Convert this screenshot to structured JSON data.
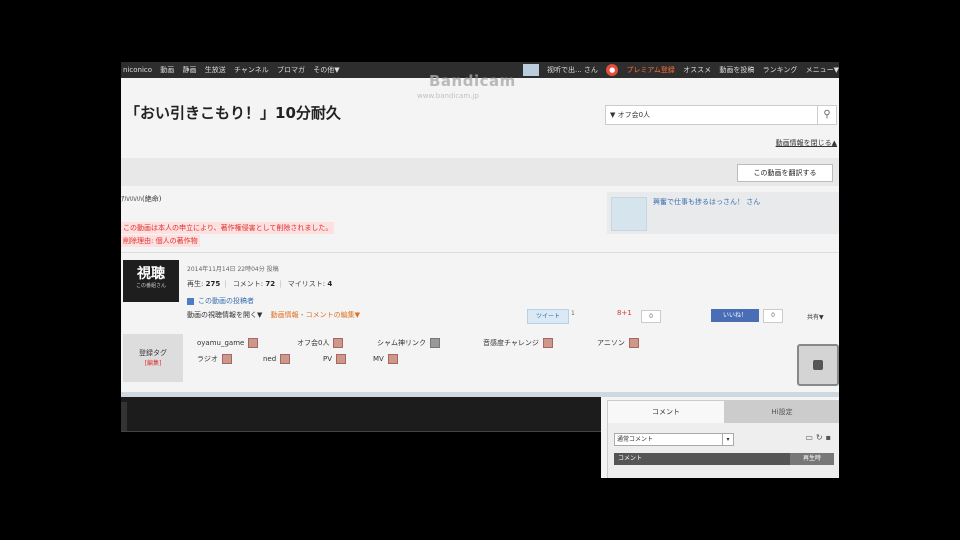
{
  "nav": {
    "left": [
      "niconico",
      "動画",
      "静画",
      "生放送",
      "チャンネル",
      "ブロマガ",
      "その他▼"
    ],
    "user": "视听で出... さん",
    "right": [
      "プレミアム登録",
      "オススメ",
      "動画を投稿",
      "ランキング",
      "メニュー▼"
    ]
  },
  "watermark": {
    "title": "Bandicam",
    "url": "www.bandicam.jp"
  },
  "video": {
    "title": "「おい引きこもり！」10分耐久",
    "search_placeholder": "▼ オフ会0人",
    "collapse_label": "動画情報を閉じる▲",
    "save_label": "この動画を翻訳する",
    "description": "ｱﾊﾊﾊﾊﾊ(絶命)",
    "notice1": "この動画は本人の申立により、著作権侵害として削除されました。",
    "notice2": "削除理由: 個人の著作物",
    "date": "2014年11月14日 22時04分 投稿",
    "stats": {
      "views_label": "再生:",
      "views": "275",
      "comments_label": "コメント:",
      "comments": "72",
      "mylist_label": "マイリスト:",
      "mylist": "4"
    },
    "owner_link": "この動画の投稿者",
    "links_a": "動画の視聴情報を開く▼",
    "links_b": "動画情報・コメントの編集▼"
  },
  "channel": {
    "big": "視聴",
    "small": "この番組さん"
  },
  "ad": {
    "text": "興奮で仕事も捗るはっさん！ さん"
  },
  "social": {
    "tweet": "ツイート",
    "tweet_count": "1",
    "gplus": "8+1",
    "gplus_count": "0",
    "like": "いいね！",
    "like_count": "0",
    "share": "共有▼"
  },
  "tags": {
    "head": "登録タグ",
    "edit": "[編集]",
    "items": [
      "oyamu_game",
      "オフ会0人",
      "シャム神リンク",
      "音感度チャレンジ",
      "アニソン",
      "ラジオ",
      "ned",
      "PV",
      "MV"
    ]
  },
  "comments": {
    "tab_comments": "コメント",
    "tab_history": "Hi設定",
    "filter": "通常コメント",
    "col_comment": "コメント",
    "col_time": "再生時"
  }
}
